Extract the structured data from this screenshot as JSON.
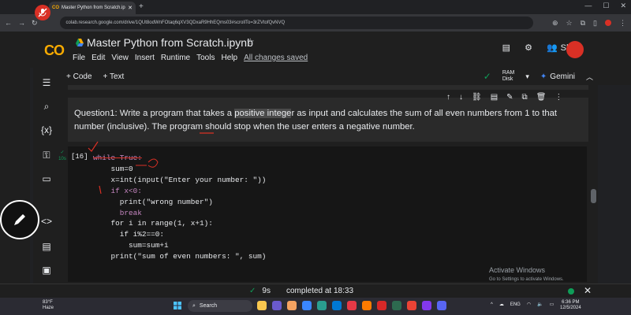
{
  "browser": {
    "tab_title": "Master Python from Scratch.ip",
    "tab_favicon": "CO",
    "url": "colab.research.google.com/drive/1QUt8odWnFOtaq6qXV3QDxaR9HhEQms03#scrollTo=3rZVtofQvNVQ"
  },
  "colab": {
    "logo": "CO",
    "notebook_title": "Master Python from Scratch.ipynb",
    "menu": [
      "File",
      "Edit",
      "View",
      "Insert",
      "Runtime",
      "Tools",
      "Help"
    ],
    "save_status": "All changes saved",
    "share_label": "Share",
    "add_code": "+ Code",
    "add_text": "+ Text",
    "ram_label": "RAM",
    "disk_label": "Disk",
    "gemini_label": "Gemini"
  },
  "markdown_cell": {
    "text_before": "Question1: Write a program that takes a ",
    "highlight": "positive intege",
    "text_after": "r as input and calculates the sum of all even numbers from 1 to that number (inclusive). The program should stop when the user enters a negative number."
  },
  "code_cell": {
    "exec_count": "[16]",
    "run_time_badge": "10s",
    "lines": [
      "while True:",
      "    sum=0",
      "    x=int(input(\"Enter your number: \"))",
      "    if x<0:",
      "      print(\"wrong number\")",
      "      break",
      "    for i in range(1, x+1):",
      "      if i%2==0:",
      "        sum=sum+i",
      "    print(\"sum of even numbers: \", sum)"
    ]
  },
  "watermark": {
    "line1": "Activate Windows",
    "line2": "Go to Settings to activate Windows."
  },
  "status": {
    "duration": "9s",
    "message": "completed at 18:33"
  },
  "taskbar": {
    "temp": "83°F",
    "weather": "Haze",
    "search_placeholder": "Search",
    "lang": "ENG",
    "time": "6:36 PM",
    "date": "12/5/2024"
  },
  "colors": {
    "accent_orange": "#f9ab00",
    "success_green": "#0f9d58",
    "record_red": "#d93025"
  }
}
